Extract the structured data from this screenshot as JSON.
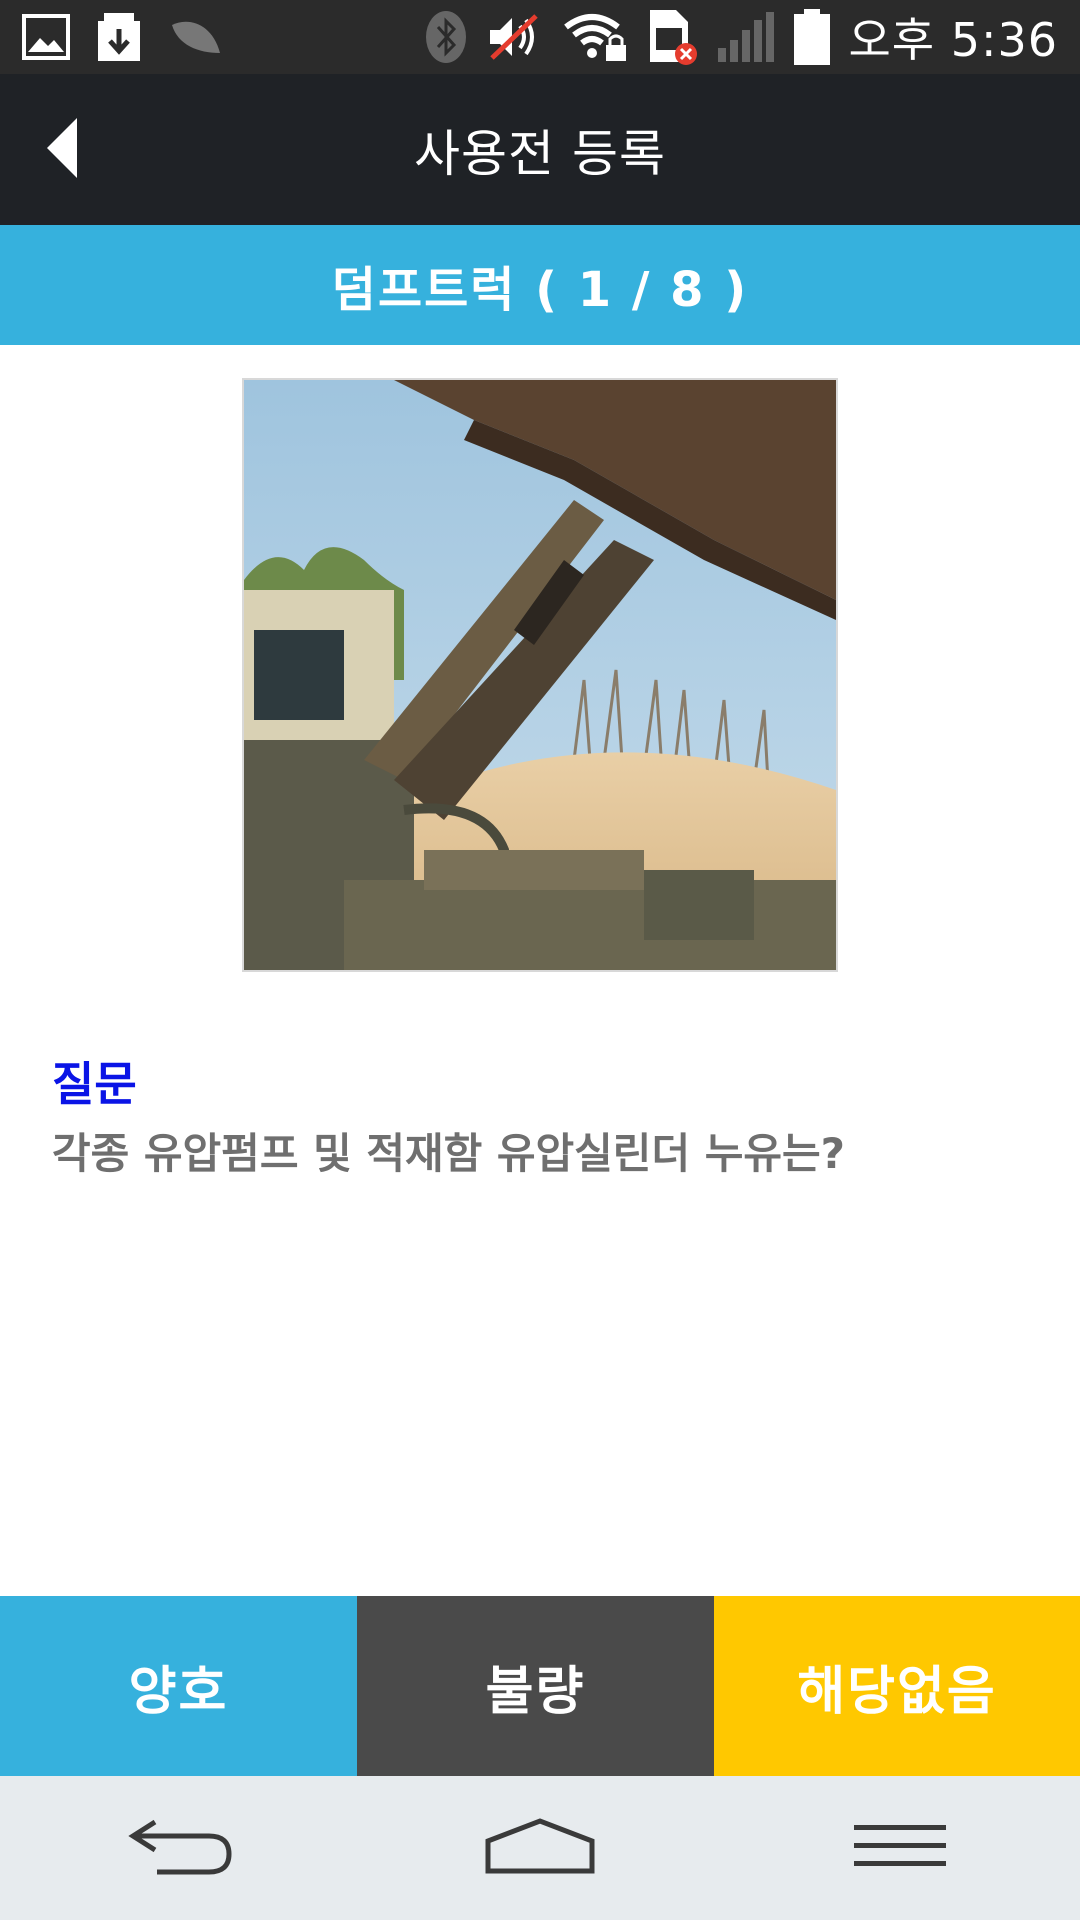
{
  "status_bar": {
    "time": "오후 5:36",
    "left_icons": [
      "gallery-icon",
      "download-icon",
      "leaf-icon"
    ],
    "right_icons": [
      "bluetooth-icon",
      "mute-icon",
      "wifi-lock-icon",
      "sim-error-icon",
      "signal-icon",
      "battery-icon"
    ]
  },
  "app_bar": {
    "title": "사용전 등록",
    "back_icon": "back-arrow-icon"
  },
  "sub_header": {
    "title": "덤프트럭 ( 1 / 8 )"
  },
  "question": {
    "label": "질문",
    "text": "각종 유압펌프 및 적재함 유압실린더 누유는?"
  },
  "answers": {
    "good_label": "양호",
    "bad_label": "불량",
    "not_applicable_label": "해당없음"
  },
  "nav_bar": {
    "icons": [
      "back-icon",
      "home-icon",
      "menu-icon"
    ]
  },
  "colors": {
    "accent_blue": "#36b1dd",
    "dark_gray": "#4a4a4a",
    "yellow": "#ffc800",
    "question_label": "#0a14e6"
  }
}
